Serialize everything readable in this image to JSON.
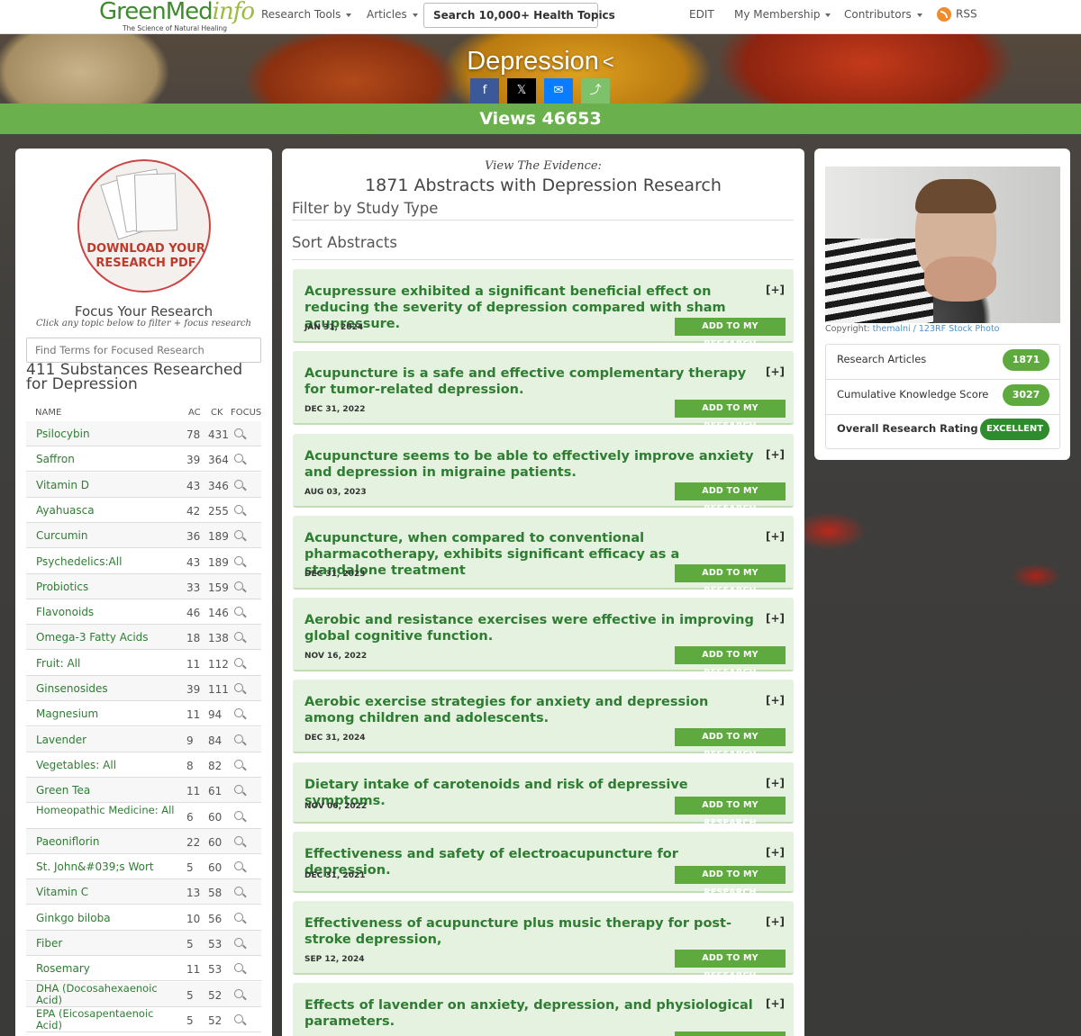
{
  "nav": {
    "logo_main": "GreenMed",
    "logo_italic": "info",
    "logo_tagline": "The Science of Natural Healing",
    "research_tools": "Research Tools",
    "articles": "Articles",
    "search_topics": "Search 10,000+ Health Topics",
    "edit": "EDIT",
    "membership": "My Membership",
    "contributors": "Contributors",
    "rss": "RSS"
  },
  "header": {
    "title": "Depression",
    "share_glyph": "<",
    "views": "Views 46653",
    "social": [
      {
        "name": "facebook",
        "glyph": "f",
        "color": "#3b5998"
      },
      {
        "name": "x",
        "glyph": "𝕏",
        "color": "#000000"
      },
      {
        "name": "messenger",
        "glyph": "✉",
        "color": "#0a7cff"
      },
      {
        "name": "share",
        "glyph": "⤴",
        "color": "#7dc26a"
      }
    ]
  },
  "left": {
    "pdf_label": "DOWNLOAD YOUR RESEARCH PDF",
    "focus_title": "Focus Your Research",
    "focus_sub": "Click any topic below to filter + focus research",
    "find_placeholder": "Find Terms for Focused Research",
    "subs_title": "411 Substances Researched for Depression",
    "headers": {
      "name": "NAME",
      "ac": "AC",
      "ck": "CK",
      "focus": "FOCUS"
    },
    "rows": [
      {
        "name": "Psilocybin",
        "ac": "78",
        "ck": "431"
      },
      {
        "name": "Saffron",
        "ac": "39",
        "ck": "364"
      },
      {
        "name": "Vitamin D",
        "ac": "43",
        "ck": "346"
      },
      {
        "name": "Ayahuasca",
        "ac": "42",
        "ck": "255"
      },
      {
        "name": "Curcumin",
        "ac": "36",
        "ck": "189"
      },
      {
        "name": "Psychedelics:All",
        "ac": "43",
        "ck": "189"
      },
      {
        "name": "Probiotics",
        "ac": "33",
        "ck": "159"
      },
      {
        "name": "Flavonoids",
        "ac": "46",
        "ck": "146"
      },
      {
        "name": "Omega-3 Fatty Acids",
        "ac": "18",
        "ck": "138"
      },
      {
        "name": "Fruit: All",
        "ac": "11",
        "ck": "112"
      },
      {
        "name": "Ginsenosides",
        "ac": "39",
        "ck": "111"
      },
      {
        "name": "Magnesium",
        "ac": "11",
        "ck": "94"
      },
      {
        "name": "Lavender",
        "ac": "9",
        "ck": "84"
      },
      {
        "name": "Vegetables: All",
        "ac": "8",
        "ck": "82"
      },
      {
        "name": "Green Tea",
        "ac": "11",
        "ck": "61"
      },
      {
        "name": "Homeopathic Medicine: All",
        "ac": "6",
        "ck": "60"
      },
      {
        "name": "Paeoniflorin",
        "ac": "22",
        "ck": "60"
      },
      {
        "name": "St. John&#039;s Wort",
        "ac": "5",
        "ck": "60"
      },
      {
        "name": "Vitamin C",
        "ac": "13",
        "ck": "58"
      },
      {
        "name": "Ginkgo biloba",
        "ac": "10",
        "ck": "56"
      },
      {
        "name": "Fiber",
        "ac": "5",
        "ck": "53"
      },
      {
        "name": "Rosemary",
        "ac": "11",
        "ck": "53"
      },
      {
        "name": "DHA (Docosahexaenoic Acid)",
        "ac": "5",
        "ck": "52"
      },
      {
        "name": "EPA (Eicosapentaenoic Acid)",
        "ac": "5",
        "ck": "52"
      }
    ]
  },
  "center": {
    "evidence": "View The Evidence:",
    "abstracts_title": "1871 Abstracts with Depression Research",
    "filter_label": "Filter by Study Type",
    "sort_label": "Sort Abstracts",
    "plus_label": "[+]",
    "add_label": "ADD TO MY RESEARCH",
    "cards": [
      {
        "title": "Acupressure exhibited a significant beneficial effect on reducing the severity of depression compared with sham acupressure.",
        "date": "JAN 31, 2024"
      },
      {
        "title": "Acupuncture is a safe and effective complementary therapy for tumor-related depression.",
        "date": "DEC 31, 2022"
      },
      {
        "title": "Acupuncture seems to be able to effectively improve anxiety and depression in migraine patients.",
        "date": "AUG 03, 2023"
      },
      {
        "title": "Acupuncture, when compared to conventional pharmacotherapy, exhibits significant efficacy as a standalone treatment",
        "date": "DEC 31, 2023"
      },
      {
        "title": "Aerobic and resistance exercises were effective in improving global cognitive function.",
        "date": "NOV 16, 2022"
      },
      {
        "title": "Aerobic exercise strategies for anxiety and depression among children and adolescents.",
        "date": "DEC 31, 2024"
      },
      {
        "title": "Dietary intake of carotenoids and risk of depressive symptoms.",
        "date": "NOV 06, 2022"
      },
      {
        "title": "Effectiveness and safety of electroacupuncture for depression.",
        "date": "DEC 31, 2021"
      },
      {
        "title": "Effectiveness of acupuncture plus music therapy for post-stroke depression,",
        "date": "SEP 12, 2024"
      },
      {
        "title": "Effects of lavender on anxiety, depression, and physiological parameters.",
        "date": ""
      }
    ]
  },
  "right": {
    "copyright_prefix": "Copyright:",
    "copyright_credit": "themalni / 123RF Stock Photo",
    "stats": [
      {
        "label": "Research Articles",
        "value": "1871"
      },
      {
        "label": "Cumulative Knowledge Score",
        "value": "3027"
      },
      {
        "label": "Overall Research Rating",
        "value": "EXCELLENT"
      }
    ]
  }
}
